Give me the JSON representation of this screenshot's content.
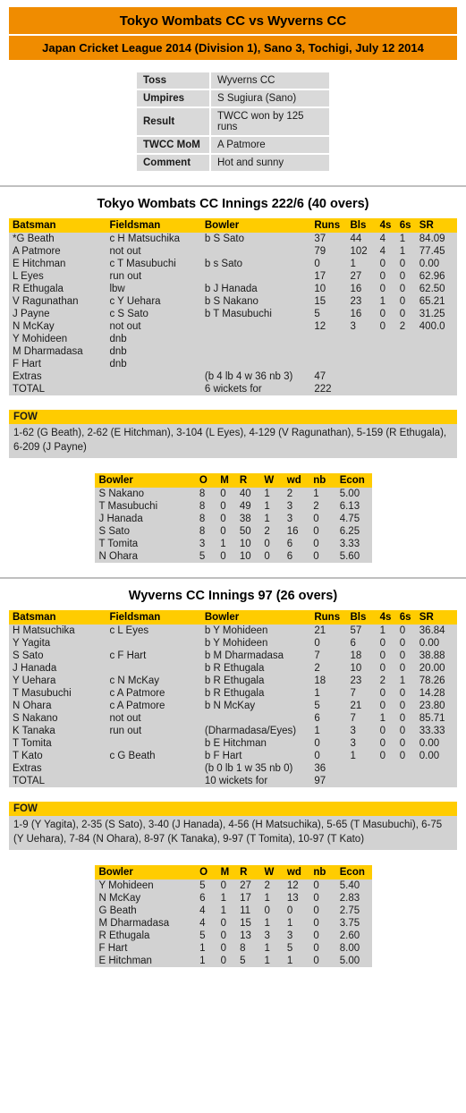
{
  "header": {
    "match_title": "Tokyo Wombats CC vs Wyverns CC",
    "match_subtitle": "Japan Cricket League 2014 (Division 1), Sano 3, Tochigi, July 12 2014",
    "accent_orange": "#F08C00",
    "accent_yellow": "#FFCC00",
    "row_background": "#d2d2d2"
  },
  "info": {
    "rows": [
      {
        "label": "Toss",
        "value": "Wyverns CC"
      },
      {
        "label": "Umpires",
        "value": "S Sugiura (Sano)"
      },
      {
        "label": "Result",
        "value": "TWCC won by 125 runs"
      },
      {
        "label": "TWCC MoM",
        "value": "A Patmore"
      },
      {
        "label": "Comment",
        "value": "Hot and sunny"
      }
    ]
  },
  "batting_columns": [
    "Batsman",
    "Fieldsman",
    "Bowler",
    "Runs",
    "Bls",
    "4s",
    "6s",
    "SR"
  ],
  "bowling_columns": [
    "Bowler",
    "O",
    "M",
    "R",
    "W",
    "wd",
    "nb",
    "Econ"
  ],
  "fow_label": "FOW",
  "innings": [
    {
      "title": "Tokyo Wombats CC Innings 222/6 (40 overs)",
      "batting": [
        {
          "batsman": "*G Beath",
          "fieldsman": "c H Matsuchika",
          "bowler": "b S Sato",
          "runs": "37",
          "bls": "44",
          "fours": "4",
          "sixes": "1",
          "sr": "84.09"
        },
        {
          "batsman": "A Patmore",
          "fieldsman": "not out",
          "bowler": "",
          "runs": "79",
          "bls": "102",
          "fours": "4",
          "sixes": "1",
          "sr": "77.45"
        },
        {
          "batsman": "E Hitchman",
          "fieldsman": "c T Masubuchi",
          "bowler": "b s Sato",
          "runs": "0",
          "bls": "1",
          "fours": "0",
          "sixes": "0",
          "sr": "0.00"
        },
        {
          "batsman": "L Eyes",
          "fieldsman": "run out",
          "bowler": "",
          "runs": "17",
          "bls": "27",
          "fours": "0",
          "sixes": "0",
          "sr": "62.96"
        },
        {
          "batsman": "R Ethugala",
          "fieldsman": "lbw",
          "bowler": "b J Hanada",
          "runs": "10",
          "bls": "16",
          "fours": "0",
          "sixes": "0",
          "sr": "62.50"
        },
        {
          "batsman": "V Ragunathan",
          "fieldsman": "c Y Uehara",
          "bowler": "b S Nakano",
          "runs": "15",
          "bls": "23",
          "fours": "1",
          "sixes": "0",
          "sr": "65.21"
        },
        {
          "batsman": "J Payne",
          "fieldsman": "c S Sato",
          "bowler": "b T Masubuchi",
          "runs": "5",
          "bls": "16",
          "fours": "0",
          "sixes": "0",
          "sr": "31.25"
        },
        {
          "batsman": "N McKay",
          "fieldsman": "not out",
          "bowler": "",
          "runs": "12",
          "bls": "3",
          "fours": "0",
          "sixes": "2",
          "sr": "400.0"
        },
        {
          "batsman": "Y Mohideen",
          "fieldsman": "dnb",
          "bowler": "",
          "runs": "",
          "bls": "",
          "fours": "",
          "sixes": "",
          "sr": ""
        },
        {
          "batsman": "M Dharmadasa",
          "fieldsman": "dnb",
          "bowler": "",
          "runs": "",
          "bls": "",
          "fours": "",
          "sixes": "",
          "sr": ""
        },
        {
          "batsman": "F Hart",
          "fieldsman": "dnb",
          "bowler": "",
          "runs": "",
          "bls": "",
          "fours": "",
          "sixes": "",
          "sr": ""
        },
        {
          "batsman": "Extras",
          "fieldsman": "",
          "bowler": "(b 4 lb 4 w 36 nb 3)",
          "runs": "47",
          "bls": "",
          "fours": "",
          "sixes": "",
          "sr": ""
        },
        {
          "batsman": "TOTAL",
          "fieldsman": "",
          "bowler": "6 wickets for",
          "runs": "222",
          "bls": "",
          "fours": "",
          "sixes": "",
          "sr": ""
        }
      ],
      "fow": "1-62 (G Beath), 2-62 (E Hitchman), 3-104 (L Eyes), 4-129 (V Ragunathan), 5-159 (R Ethugala), 6-209 (J Payne)",
      "bowling": [
        {
          "bowler": "S Nakano",
          "o": "8",
          "m": "0",
          "r": "40",
          "w": "1",
          "wd": "2",
          "nb": "1",
          "econ": "5.00"
        },
        {
          "bowler": "T Masubuchi",
          "o": "8",
          "m": "0",
          "r": "49",
          "w": "1",
          "wd": "3",
          "nb": "2",
          "econ": "6.13"
        },
        {
          "bowler": "J Hanada",
          "o": "8",
          "m": "0",
          "r": "38",
          "w": "1",
          "wd": "3",
          "nb": "0",
          "econ": "4.75"
        },
        {
          "bowler": "S Sato",
          "o": "8",
          "m": "0",
          "r": "50",
          "w": "2",
          "wd": "16",
          "nb": "0",
          "econ": "6.25"
        },
        {
          "bowler": "T Tomita",
          "o": "3",
          "m": "1",
          "r": "10",
          "w": "0",
          "wd": "6",
          "nb": "0",
          "econ": "3.33"
        },
        {
          "bowler": "N Ohara",
          "o": "5",
          "m": "0",
          "r": "10",
          "w": "0",
          "wd": "6",
          "nb": "0",
          "econ": "5.60"
        }
      ]
    },
    {
      "title": "Wyverns CC Innings 97 (26 overs)",
      "batting": [
        {
          "batsman": "H Matsuchika",
          "fieldsman": "c L Eyes",
          "bowler": "b Y Mohideen",
          "runs": "21",
          "bls": "57",
          "fours": "1",
          "sixes": "0",
          "sr": "36.84"
        },
        {
          "batsman": "Y Yagita",
          "fieldsman": "",
          "bowler": "b Y Mohideen",
          "runs": "0",
          "bls": "6",
          "fours": "0",
          "sixes": "0",
          "sr": "0.00"
        },
        {
          "batsman": "S Sato",
          "fieldsman": "c F Hart",
          "bowler": "b M Dharmadasa",
          "runs": "7",
          "bls": "18",
          "fours": "0",
          "sixes": "0",
          "sr": "38.88"
        },
        {
          "batsman": "J Hanada",
          "fieldsman": "",
          "bowler": "b R Ethugala",
          "runs": "2",
          "bls": "10",
          "fours": "0",
          "sixes": "0",
          "sr": "20.00"
        },
        {
          "batsman": "Y Uehara",
          "fieldsman": "c N McKay",
          "bowler": "b R Ethugala",
          "runs": "18",
          "bls": "23",
          "fours": "2",
          "sixes": "1",
          "sr": "78.26"
        },
        {
          "batsman": "T Masubuchi",
          "fieldsman": "c A Patmore",
          "bowler": "b R Ethugala",
          "runs": "1",
          "bls": "7",
          "fours": "0",
          "sixes": "0",
          "sr": "14.28"
        },
        {
          "batsman": "N Ohara",
          "fieldsman": "c A Patmore",
          "bowler": "b N McKay",
          "runs": "5",
          "bls": "21",
          "fours": "0",
          "sixes": "0",
          "sr": "23.80"
        },
        {
          "batsman": "S Nakano",
          "fieldsman": "not out",
          "bowler": "",
          "runs": "6",
          "bls": "7",
          "fours": "1",
          "sixes": "0",
          "sr": "85.71"
        },
        {
          "batsman": "K Tanaka",
          "fieldsman": "run out",
          "bowler": "(Dharmadasa/Eyes)",
          "runs": "1",
          "bls": "3",
          "fours": "0",
          "sixes": "0",
          "sr": "33.33"
        },
        {
          "batsman": "T Tomita",
          "fieldsman": "",
          "bowler": "b E Hitchman",
          "runs": "0",
          "bls": "3",
          "fours": "0",
          "sixes": "0",
          "sr": "0.00"
        },
        {
          "batsman": "T Kato",
          "fieldsman": "c G Beath",
          "bowler": "b F Hart",
          "runs": "0",
          "bls": "1",
          "fours": "0",
          "sixes": "0",
          "sr": "0.00"
        },
        {
          "batsman": "Extras",
          "fieldsman": "",
          "bowler": "(b 0 lb 1 w 35 nb 0)",
          "runs": "36",
          "bls": "",
          "fours": "",
          "sixes": "",
          "sr": ""
        },
        {
          "batsman": "TOTAL",
          "fieldsman": "",
          "bowler": "10 wickets for",
          "runs": "97",
          "bls": "",
          "fours": "",
          "sixes": "",
          "sr": ""
        }
      ],
      "fow": "1-9 (Y Yagita), 2-35 (S Sato), 3-40 (J Hanada), 4-56 (H Matsuchika), 5-65 (T Masubuchi), 6-75 (Y Uehara), 7-84 (N Ohara), 8-97 (K Tanaka), 9-97 (T Tomita), 10-97 (T Kato)",
      "bowling": [
        {
          "bowler": "Y Mohideen",
          "o": "5",
          "m": "0",
          "r": "27",
          "w": "2",
          "wd": "12",
          "nb": "0",
          "econ": "5.40"
        },
        {
          "bowler": "N McKay",
          "o": "6",
          "m": "1",
          "r": "17",
          "w": "1",
          "wd": "13",
          "nb": "0",
          "econ": "2.83"
        },
        {
          "bowler": "G Beath",
          "o": "4",
          "m": "1",
          "r": "11",
          "w": "0",
          "wd": "0",
          "nb": "0",
          "econ": "2.75"
        },
        {
          "bowler": "M Dharmadasa",
          "o": "4",
          "m": "0",
          "r": "15",
          "w": "1",
          "wd": "1",
          "nb": "0",
          "econ": "3.75"
        },
        {
          "bowler": "R Ethugala",
          "o": "5",
          "m": "0",
          "r": "13",
          "w": "3",
          "wd": "3",
          "nb": "0",
          "econ": "2.60"
        },
        {
          "bowler": "F Hart",
          "o": "1",
          "m": "0",
          "r": "8",
          "w": "1",
          "wd": "5",
          "nb": "0",
          "econ": "8.00"
        },
        {
          "bowler": "E Hitchman",
          "o": "1",
          "m": "0",
          "r": "5",
          "w": "1",
          "wd": "1",
          "nb": "0",
          "econ": "5.00"
        }
      ]
    }
  ]
}
